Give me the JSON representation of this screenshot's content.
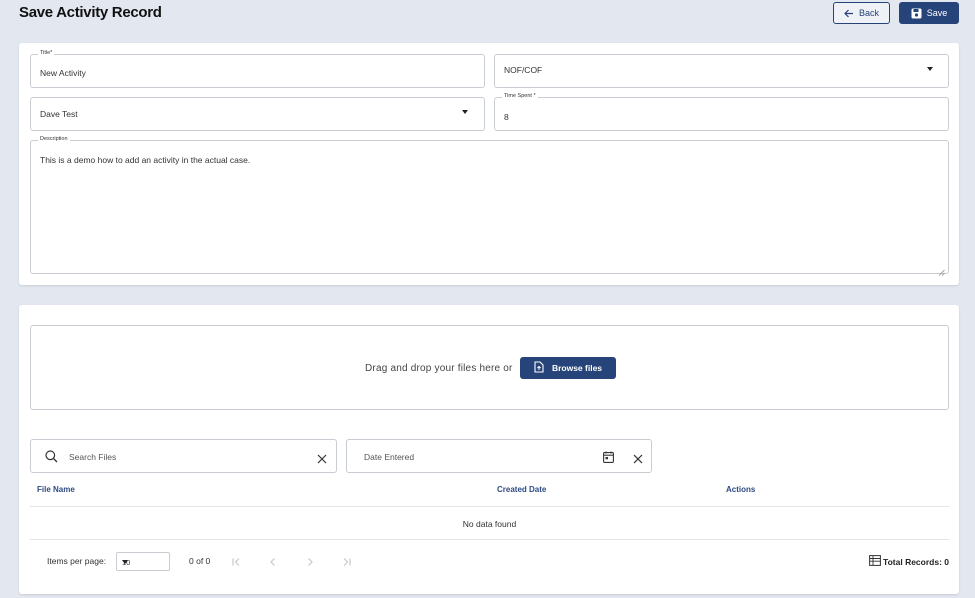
{
  "header": {
    "title": "Save Activity Record",
    "back_label": "Back",
    "save_label": "Save"
  },
  "form": {
    "title_field": {
      "label": "Title*",
      "value": "New Activity"
    },
    "category_select": {
      "value": "NOF/COF"
    },
    "user_select": {
      "value": "Dave Test"
    },
    "time_spent": {
      "label": "Time Spent *",
      "value": "8"
    },
    "description": {
      "label": "Description",
      "value": "This is a demo how to add an activity in the actual case."
    }
  },
  "upload": {
    "dropzone_text": "Drag and drop your files here or",
    "browse_label": "Browse files"
  },
  "filters": {
    "search_placeholder": "Search Files",
    "date_placeholder": "Date Entered"
  },
  "table": {
    "columns": [
      "File Name",
      "Created Date",
      "Actions"
    ],
    "empty_text": "No data found"
  },
  "paginator": {
    "items_per_page_label": "Items per page:",
    "page_size": "10",
    "range_label": "0 of 0",
    "total_label": "Total Records: 0"
  },
  "colors": {
    "primary": "#27447a",
    "background": "#e3e8f0",
    "header_text": "#2d4a85"
  }
}
